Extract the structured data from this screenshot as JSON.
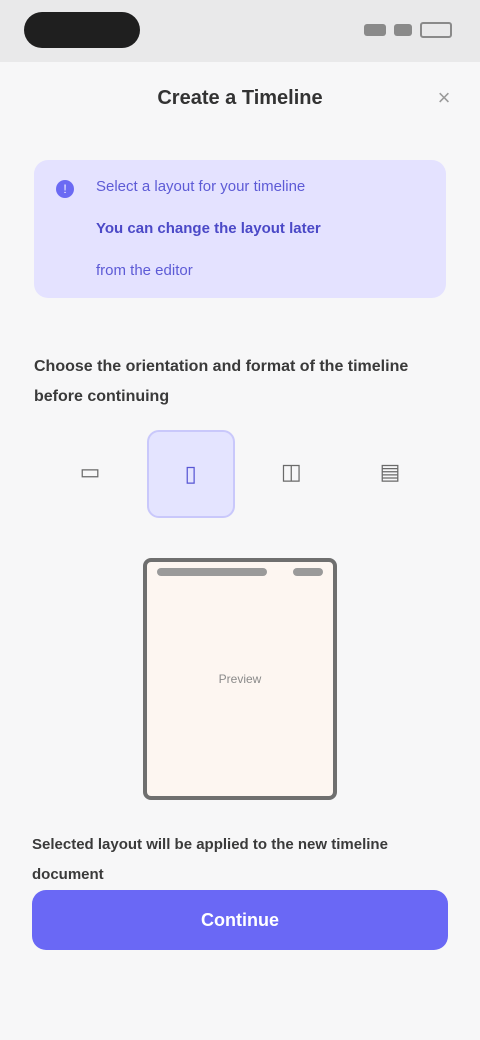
{
  "header": {
    "title": "Create a Timeline",
    "close_icon": "×"
  },
  "info": {
    "icon": "!",
    "line1": "Select a layout for your timeline",
    "line2": "You can change the layout later",
    "line3": "from the editor"
  },
  "instruction": "Choose the orientation and format of the timeline before continuing",
  "options": [
    {
      "glyph": "▭",
      "label": ""
    },
    {
      "glyph": "▯",
      "label": ""
    },
    {
      "glyph": "◫",
      "label": ""
    },
    {
      "glyph": "▤",
      "label": ""
    }
  ],
  "preview": {
    "label": "Preview"
  },
  "note": "Selected layout will be applied to the new timeline document",
  "primary_button": "Continue",
  "footer": ""
}
